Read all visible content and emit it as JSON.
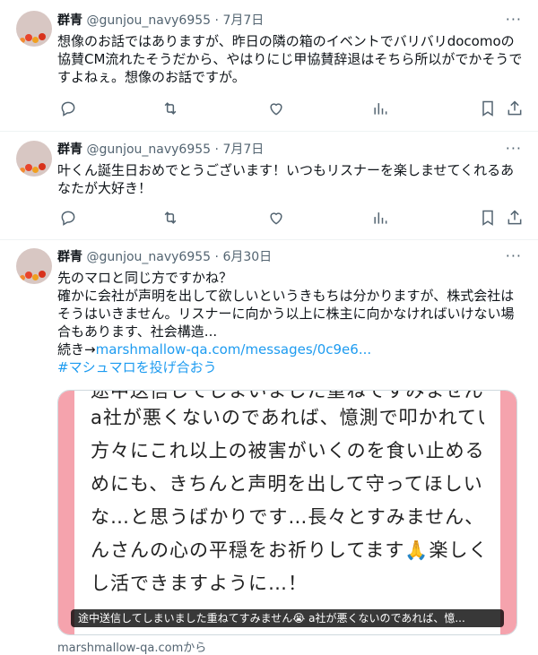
{
  "tweets": [
    {
      "name": "群青",
      "handle": "@gunjou_navy6955",
      "sep": "·",
      "date": "7月7日",
      "more": "···",
      "lines": [
        "想像のお話ではありますが、昨日の隣の箱のイベントでバリバリdocomoの",
        "協賛CM流れたそうだから、やはりにじ甲協賛辞退はそちら所以がでかそうで",
        "すよねぇ。想像のお話ですが。"
      ]
    },
    {
      "name": "群青",
      "handle": "@gunjou_navy6955",
      "sep": "·",
      "date": "7月7日",
      "more": "···",
      "lines": [
        "叶くん誕生日おめでとうございます！いつもリスナーを楽しませてくれるあ",
        "なたが大好き！"
      ]
    },
    {
      "name": "群青",
      "handle": "@gunjou_navy6955",
      "sep": "·",
      "date": "6月30日",
      "more": "···",
      "lines": [
        "先のマロと同じ方ですかね？",
        "確かに会社が声明を出して欲しいというきもちは分かりますが、株式会社は",
        "そうはいきません。リスナーに向かう以上に株主に向かなければいけない場",
        "合もあります、社会構造..."
      ],
      "continue_prefix": "続き→",
      "continue_link": "marshmallow-qa.com/messages/0c9e6...",
      "hashtag": "#マシュマロを投げ合おう",
      "card": {
        "lines": [
          "途中送信してしまいました重ねてすみません😭",
          "a社が悪くないのであれば、憶測で叩かれている",
          "方々にこれ以上の被害がいくのを食い止めるた",
          "めにも、きちんと声明を出して守ってほしい",
          "な…と思うばかりです…長々とすみません、ぐ",
          "んさんの心の平穏をお祈りしてます🙏楽しく推",
          "し活できますように…！"
        ],
        "caption": "途中送信してしまいました重ねてすみません😭 a社が悪くないのであれば、憶...",
        "source": "marshmallow-qa.comから"
      }
    }
  ],
  "icons": [
    "reply-icon",
    "retweet-icon",
    "like-icon",
    "views-icon",
    "bookmark-icon",
    "share-icon"
  ],
  "colors": {
    "link": "#1d9bf0",
    "muted": "#536471",
    "card_band": "#f5a3ad"
  }
}
